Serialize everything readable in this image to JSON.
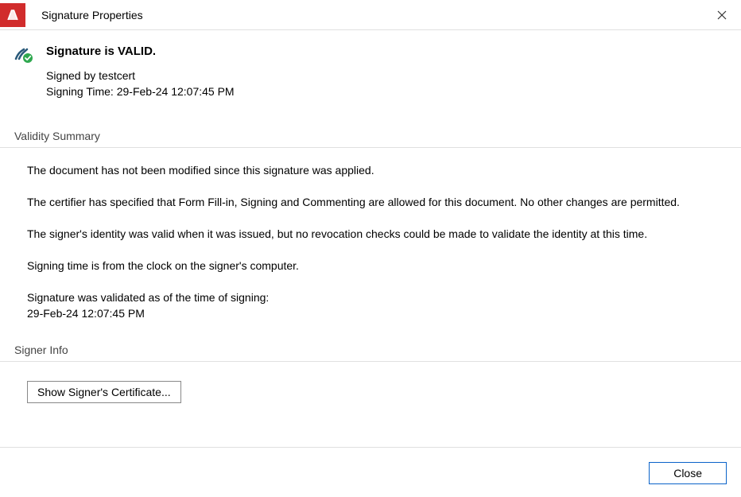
{
  "titlebar": {
    "title": "Signature Properties"
  },
  "status": {
    "heading": "Signature is VALID.",
    "signed_by": "Signed by testcert",
    "signing_time": "Signing Time: 29-Feb-24 12:07:45 PM"
  },
  "validity": {
    "header": "Validity Summary",
    "items": {
      "modification": "The document has not been modified since this signature was applied.",
      "certifier": "The certifier has specified that Form Fill-in, Signing and Commenting are allowed for this document. No other changes are permitted.",
      "identity": "The signer's identity was valid when it was issued, but no revocation checks could be made to validate the identity at this time.",
      "clock": "Signing time is from the clock on the signer's computer.",
      "validated_as_of_label": "Signature was validated as of the time of signing:",
      "validated_as_of_time": "29-Feb-24 12:07:45 PM"
    }
  },
  "signer_info": {
    "header": "Signer Info",
    "show_cert_btn": "Show Signer's Certificate..."
  },
  "footer": {
    "close_btn": "Close"
  }
}
